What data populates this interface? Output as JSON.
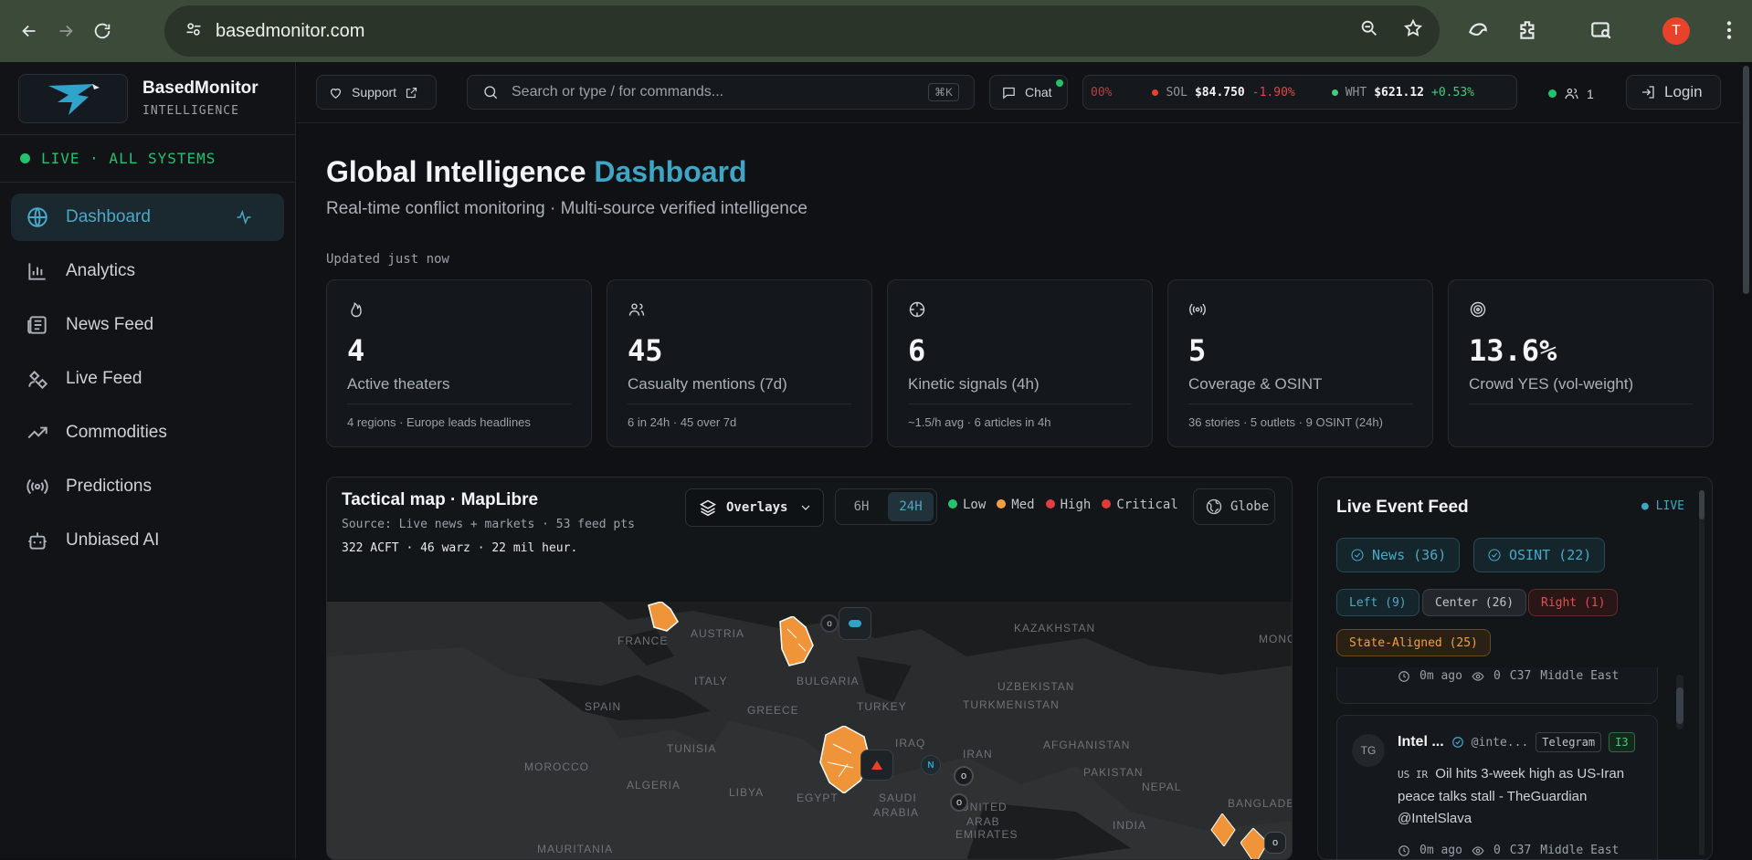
{
  "browser": {
    "url": "basedmonitor.com",
    "profile_initial": "T"
  },
  "sidebar": {
    "brand_name": "BasedMonitor",
    "brand_sub": "INTELLIGENCE",
    "live_status": "LIVE · ALL SYSTEMS",
    "items": [
      {
        "label": "Dashboard",
        "icon": "globe-icon",
        "active": true
      },
      {
        "label": "Analytics",
        "icon": "bar-chart-icon"
      },
      {
        "label": "News Feed",
        "icon": "newspaper-icon"
      },
      {
        "label": "Live Feed",
        "icon": "satellite-icon"
      },
      {
        "label": "Commodities",
        "icon": "trending-up-icon"
      },
      {
        "label": "Predictions",
        "icon": "broadcast-icon"
      },
      {
        "label": "Unbiased AI",
        "icon": "bot-icon"
      }
    ]
  },
  "topbar": {
    "support_label": "Support",
    "search_placeholder": "Search or type / for commands...",
    "search_shortcut": "⌘K",
    "chat_label": "Chat",
    "ticker_partial": "00%",
    "tickers": [
      {
        "name": "SOL",
        "price": "$84.750",
        "change": "-1.90%",
        "dot": "#e8432a",
        "direction": "down"
      },
      {
        "name": "WHT",
        "price": "$621.12",
        "change": "+0.53%",
        "dot": "#3fcf7a",
        "direction": "up"
      }
    ],
    "online_count": "1",
    "login_label": "Login"
  },
  "main": {
    "title_a": "Global Intelligence",
    "title_b": "Dashboard",
    "subtitle": "Real-time conflict monitoring · Multi-source verified intelligence",
    "updated": "Updated just now",
    "cards": [
      {
        "icon": "flame-icon",
        "value": "4",
        "label": "Active theaters",
        "sub": "4 regions · Europe leads headlines"
      },
      {
        "icon": "users-icon",
        "value": "45",
        "label": "Casualty mentions (7d)",
        "sub": "6 in 24h · 45 over 7d"
      },
      {
        "icon": "crosshair-icon",
        "value": "6",
        "label": "Kinetic signals (4h)",
        "sub": "~1.5/h avg · 6 articles in 4h"
      },
      {
        "icon": "radio-icon",
        "value": "5",
        "label": "Coverage & OSINT",
        "sub": "36 stories · 5 outlets · 9 OSINT (24h)"
      },
      {
        "icon": "target-icon",
        "value": "13.6%",
        "label": "Crowd YES (vol-weight)",
        "sub": ""
      }
    ]
  },
  "map": {
    "title": "Tactical map · MapLibre",
    "source": "Source: Live news + markets · 53 feed pts",
    "stats": "322 ACFT · 46 warz · 22 mil heur.",
    "overlays_label": "Overlays",
    "ranges": [
      "6H",
      "24H"
    ],
    "active_range": "24H",
    "legend": [
      {
        "label": "Low",
        "color": "#25c26e"
      },
      {
        "label": "Med",
        "color": "#f0a040"
      },
      {
        "label": "High",
        "color": "#e04040"
      },
      {
        "label": "Critical",
        "color": "#e03a3a"
      }
    ],
    "globe_label": "Globe",
    "places": [
      "FRANCE",
      "AUSTRIA",
      "ITALY",
      "SPAIN",
      "BULGARIA",
      "GREECE",
      "TURKEY",
      "KAZAKHSTAN",
      "UZBEKISTAN",
      "TURKMENISTAN",
      "MONG",
      "TUNISIA",
      "MOROCCO",
      "ALGERIA",
      "LIBYA",
      "EGYPT",
      "IRAQ",
      "IRAN",
      "AFGHANISTAN",
      "PAKISTAN",
      "SAUDI",
      "ARABIA",
      "UNITED",
      "ARAB",
      "EMIRATES",
      "NEPAL",
      "INDIA",
      "BANGLADESH",
      "MAURITANIA"
    ]
  },
  "feed": {
    "title": "Live Event Feed",
    "live_label": "● LIVE",
    "chips": [
      {
        "label": "News (36)"
      },
      {
        "label": "OSINT (22)"
      }
    ],
    "bias_tags": [
      {
        "label": "Left (9)",
        "kind": "left"
      },
      {
        "label": "Center (26)",
        "kind": "center"
      },
      {
        "label": "Right (1)",
        "kind": "right"
      },
      {
        "label": "State-Aligned (25)",
        "kind": "state"
      }
    ],
    "items": [
      {
        "time": "0m ago",
        "views": "0",
        "code": "C37",
        "region": "Middle East"
      },
      {
        "avatar": "TG",
        "author": "Intel ...",
        "handle": "@inte...",
        "source": "Telegram",
        "level": "I3",
        "flags": "US IR",
        "text": "Oil hits 3-week high as US-Iran peace talks stall - TheGuardian @IntelSlava",
        "time": "0m ago",
        "views": "0",
        "code": "C37",
        "region": "Middle East"
      }
    ]
  }
}
